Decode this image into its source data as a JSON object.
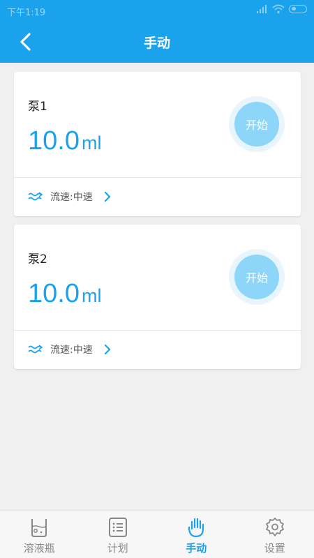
{
  "status_bar": {
    "time": "下午1:19"
  },
  "header": {
    "title": "手动"
  },
  "pumps": [
    {
      "name": "泵1",
      "volume": "10.0",
      "unit": "ml",
      "start_label": "开始",
      "flow_label": "流速:中速"
    },
    {
      "name": "泵2",
      "volume": "10.0",
      "unit": "ml",
      "start_label": "开始",
      "flow_label": "流速:中速"
    }
  ],
  "nav": {
    "items": [
      {
        "label": "溶液瓶",
        "icon": "bottle-icon",
        "active": false
      },
      {
        "label": "计划",
        "icon": "list-icon",
        "active": false
      },
      {
        "label": "手动",
        "icon": "hand-icon",
        "active": true
      },
      {
        "label": "设置",
        "icon": "gear-icon",
        "active": false
      }
    ]
  },
  "colors": {
    "primary": "#1aa3ec",
    "start_button": "#8dd6fa",
    "start_ring": "#e9f5fd",
    "background": "#f0f0f0",
    "inactive_nav": "#888888"
  }
}
